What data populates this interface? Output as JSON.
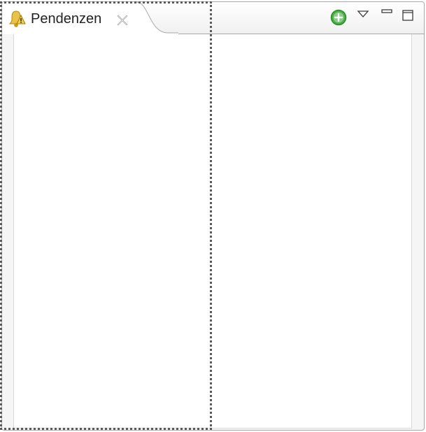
{
  "view": {
    "tab_label": "Pendenzen"
  }
}
